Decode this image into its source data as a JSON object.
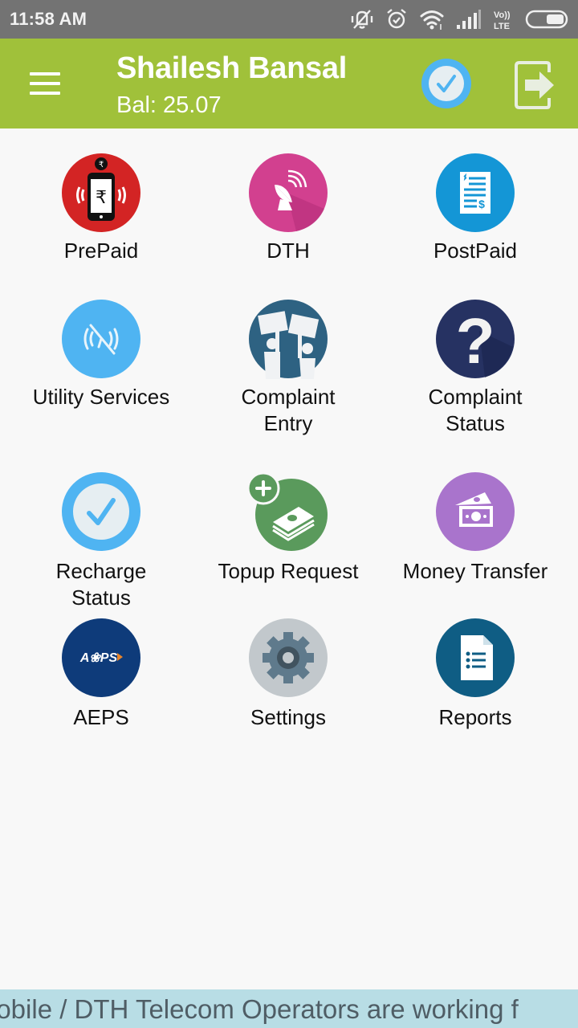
{
  "status_bar": {
    "time": "11:58 AM",
    "icons": [
      "vibrate-off-icon",
      "alarm-icon",
      "wifi-icon",
      "signal-icon",
      "volte-icon",
      "battery-icon"
    ],
    "volte_label_top": "Vo))",
    "volte_label_bottom": "LTE"
  },
  "header": {
    "user_name": "Shailesh Bansal",
    "balance": "Bal: 25.07",
    "menu_icon": "hamburger-menu-icon",
    "verified_icon": "check-circle-icon",
    "logout_icon": "logout-icon",
    "bar_color": "#a0c13a"
  },
  "tiles": [
    {
      "label": "PrePaid",
      "icon": "prepaid-mobile-icon",
      "color": "#d32424"
    },
    {
      "label": "DTH",
      "icon": "satellite-dish-icon",
      "color": "#d2408f"
    },
    {
      "label": "PostPaid",
      "icon": "bill-icon",
      "color": "#1496d6"
    },
    {
      "label": "Utility Services",
      "icon": "utility-services-icon",
      "color": "#4fb4f2"
    },
    {
      "label": "Complaint Entry",
      "label_line1": "Complaint",
      "label_line2": "Entry",
      "icon": "complaint-protest-icon",
      "color": "#2e6282"
    },
    {
      "label": "Complaint Status",
      "label_line1": "Complaint",
      "label_line2": "Status",
      "icon": "question-mark-icon",
      "color": "#263262"
    },
    {
      "label": "Recharge Status",
      "label_line1": "Recharge",
      "label_line2": "Status",
      "icon": "check-circle-icon",
      "color": "#4fb4f2"
    },
    {
      "label": "Topup Request",
      "icon": "money-stack-add-icon",
      "color": "#5a9a5c"
    },
    {
      "label": "Money Transfer",
      "icon": "money-transfer-icon",
      "color": "#a974cc"
    },
    {
      "label": "AEPS",
      "icon": "aeps-logo-icon",
      "icon_text": "A❀PS",
      "color": "#0e3b7a"
    },
    {
      "label": "Settings",
      "icon": "gear-icon",
      "color": "#c2c8cc"
    },
    {
      "label": "Reports",
      "icon": "report-document-icon",
      "color": "#0f5d84"
    }
  ],
  "ticker": {
    "text": "lobile / DTH Telecom Operators are working f"
  }
}
